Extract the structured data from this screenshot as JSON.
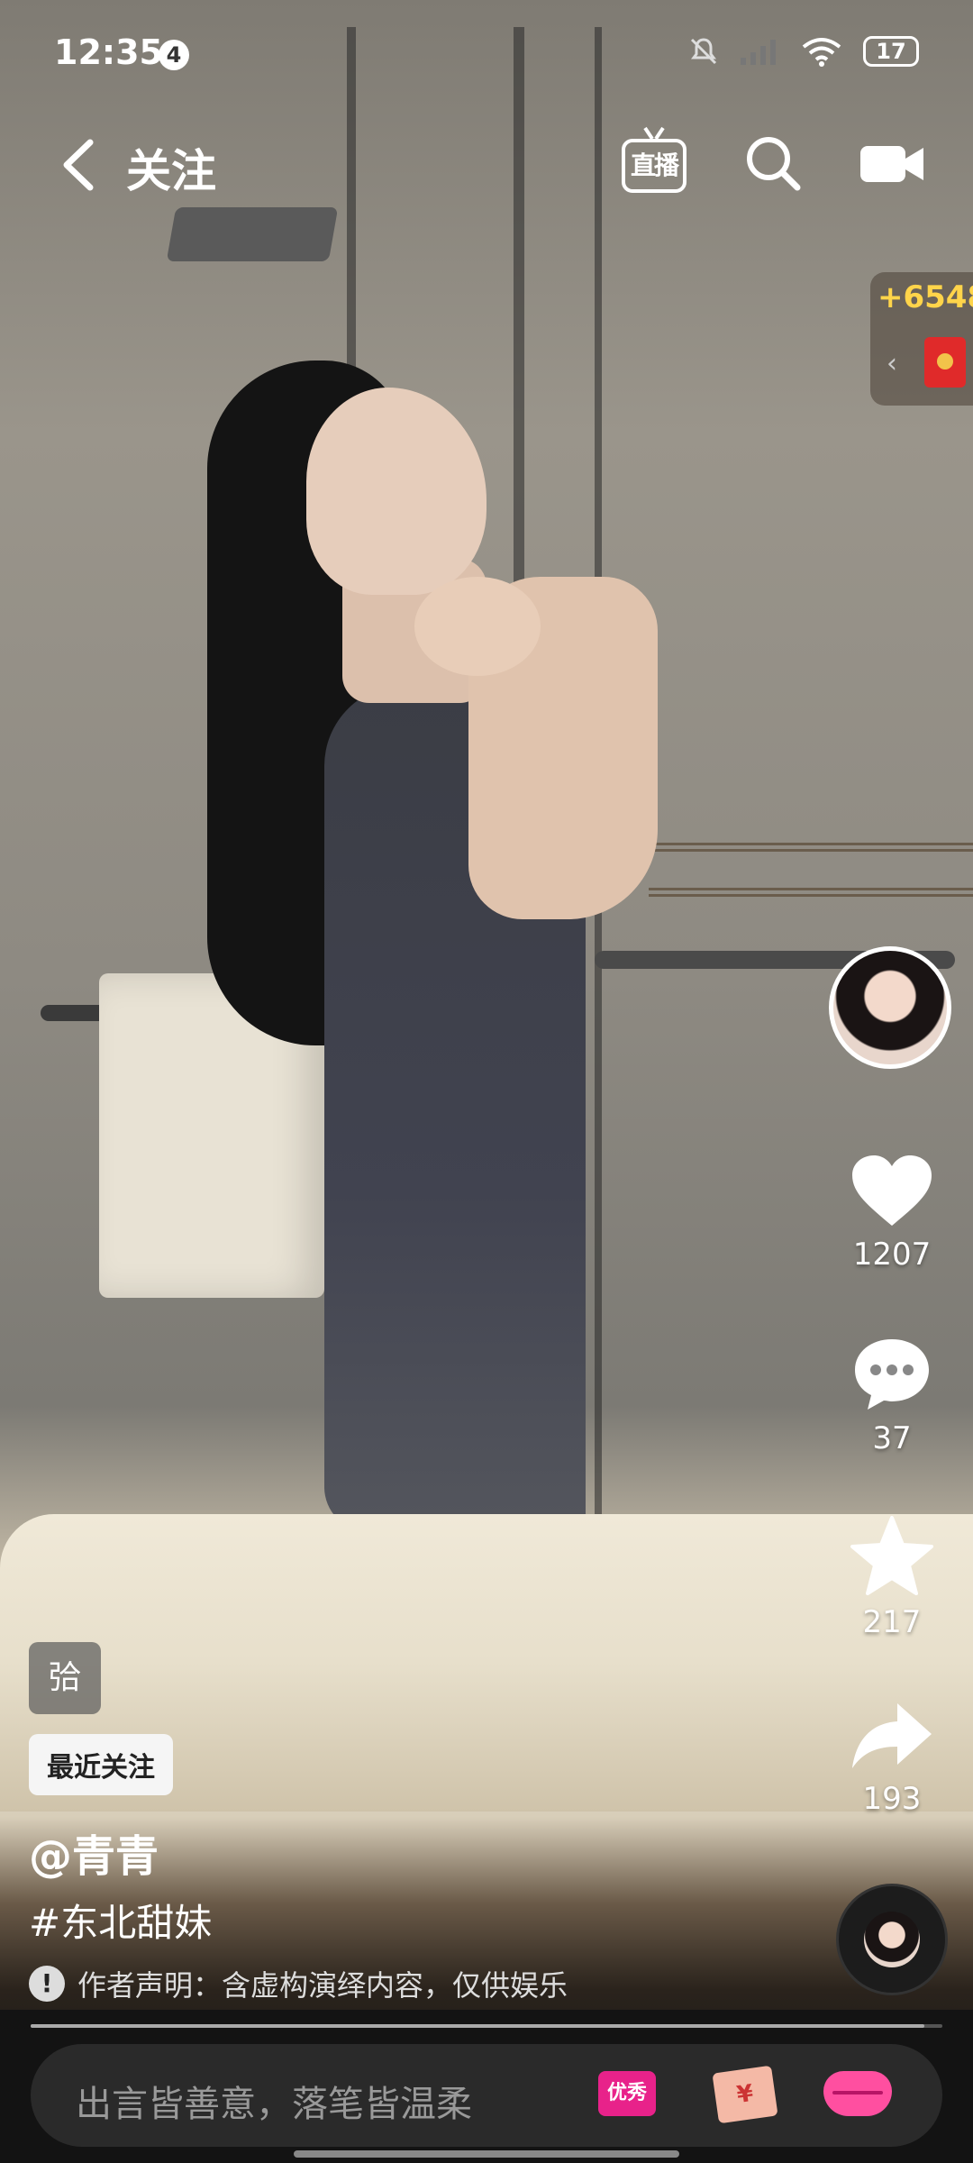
{
  "status_bar": {
    "time": "12:35",
    "notification_count": "4",
    "battery_level": "17"
  },
  "top_nav": {
    "title": "关注",
    "live_label": "直播"
  },
  "reward_widget": {
    "amount": "+6548"
  },
  "rail": {
    "likes": "1207",
    "comments": "37",
    "favorites": "217",
    "shares": "193"
  },
  "post": {
    "tag_glyph": "㢵",
    "recent_label": "最近关注",
    "username": "@青青",
    "hashtag": "#东北甜妹",
    "disclaimer": "作者声明：含虚构演绎内容，仅供娱乐"
  },
  "bottom_bar": {
    "comment_placeholder": "出言皆善意，落笔皆温柔",
    "badge_label": "优秀",
    "progress": 0.98
  },
  "colors": {
    "reward_amount": "#ffd44a",
    "badge": "#e8228a",
    "lips": "#ff4fa0"
  }
}
